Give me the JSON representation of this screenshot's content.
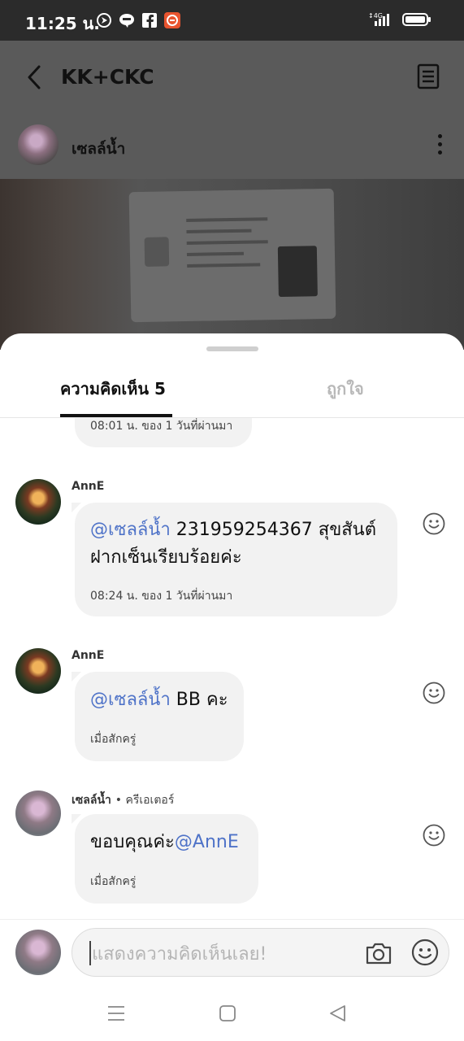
{
  "status_bar": {
    "time": "11:25 น.",
    "network": "4G"
  },
  "header": {
    "title": "KK+CKC"
  },
  "post": {
    "author": "เซลล์น้ำ"
  },
  "tabs": {
    "comments_label": "ความคิดเห็น 5",
    "likes_label": "ถูกใจ"
  },
  "comments": {
    "partial_time": "08:01 น. ของ 1 วันที่ผ่านมา",
    "items": [
      {
        "user": "AnnE",
        "mention": "@เซลล์น้ำ",
        "text": " 231959254367 สุขสันต์ฝากเซ็นเรียบร้อยค่ะ",
        "time": "08:24 น. ของ 1 วันที่ผ่านมา"
      },
      {
        "user": "AnnE",
        "mention": "@เซลล์น้ำ",
        "text": " BB คะ",
        "time": "เมื่อสักครู่"
      },
      {
        "user": "เซลล์น้ำ",
        "role": "• ครีเอเตอร์",
        "text": "ขอบคุณค่ะ",
        "mention": "@AnnE",
        "time": "เมื่อสักครู่"
      }
    ]
  },
  "composer": {
    "placeholder": "แสดงความคิดเห็นเลย!"
  },
  "colors": {
    "mention": "#4f73c8",
    "bubble": "#f2f2f2",
    "status_bar": "#2b2b2b"
  }
}
